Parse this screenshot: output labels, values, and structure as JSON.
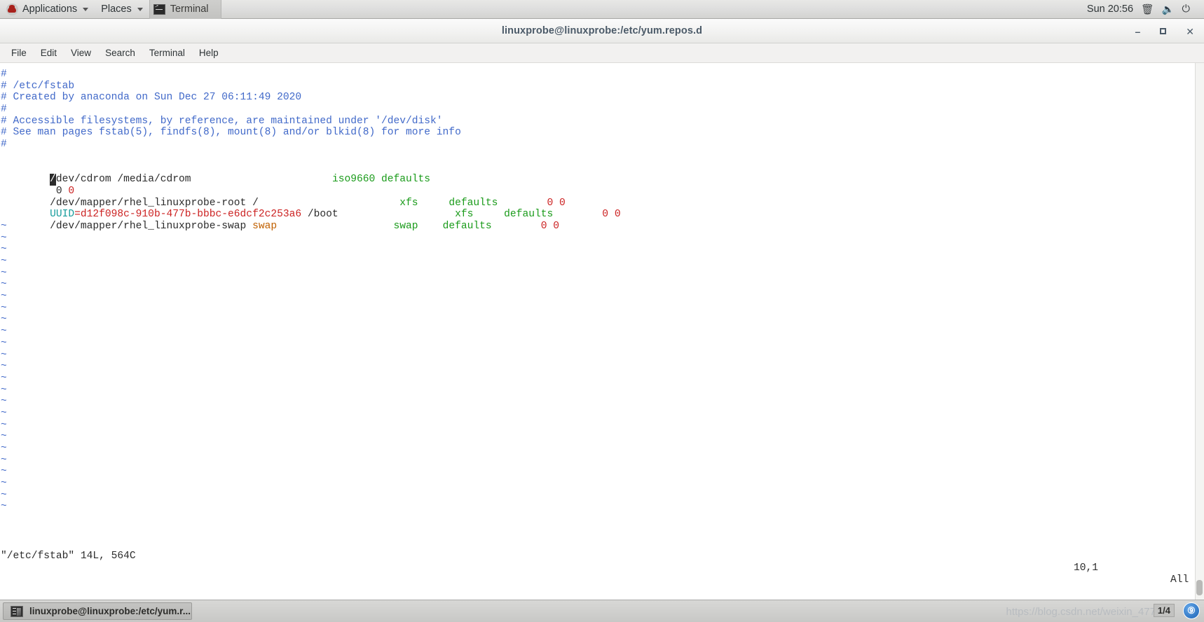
{
  "top_panel": {
    "applications_label": "Applications",
    "places_label": "Places",
    "window_button_label": "Terminal",
    "clock": "Sun 20:56",
    "icons": [
      "redhat-logo-icon",
      "display-icon",
      "volume-icon",
      "power-icon",
      "chevron-down-icon"
    ]
  },
  "window": {
    "title": "linuxprobe@linuxprobe:/etc/yum.repos.d",
    "controls": {
      "minimize": "–",
      "maximize": "",
      "close": "✕"
    },
    "menu": [
      "File",
      "Edit",
      "View",
      "Search",
      "Terminal",
      "Help"
    ]
  },
  "terminal": {
    "comments": [
      "#",
      "# /etc/fstab",
      "# Created by anaconda on Sun Dec 27 06:11:49 2020",
      "#",
      "# Accessible filesystems, by reference, are maintained under '/dev/disk'",
      "# See man pages fstab(5), findfs(8), mount(8) and/or blkid(8) for more info",
      "#"
    ],
    "entries": {
      "cdrom": {
        "cursor_char": "/",
        "device_rest": "dev/cdrom /media/cdrom",
        "spacer1": "                       ",
        "fstype": "iso9660",
        "options": " defaults",
        "wrap_dump_pass": " 0",
        "wrap_pass": " 0"
      },
      "root": {
        "device": "/dev/mapper/rhel_linuxprobe-root /",
        "spacer1": "                       ",
        "fstype": "xfs",
        "spacer2": "     ",
        "options": "defaults",
        "spacer3": "        ",
        "dump": "0",
        "pass": " 0"
      },
      "boot": {
        "uuid_key": "UUID",
        "uuid_value": "=d12f098c-910b-477b-bbbc-e6dcf2c253a6",
        "mount": " /boot",
        "spacer1": "                   ",
        "fstype": "xfs",
        "spacer2": "     ",
        "options": "defaults",
        "spacer3": "        ",
        "dump": "0",
        "pass": " 0"
      },
      "swap": {
        "device": "/dev/mapper/rhel_linuxprobe-swap ",
        "mount": "swap",
        "spacer1": "                   ",
        "fstype": "swap",
        "spacer2": "    ",
        "options": "defaults",
        "spacer3": "        ",
        "dump": "0",
        "pass": " 0"
      }
    },
    "tilde": "~",
    "tilde_count": 25,
    "status": {
      "file_info": "\"/etc/fstab\" 14L, 564C",
      "position": "10,1",
      "scroll_state": "All"
    }
  },
  "taskbar": {
    "window_label": "linuxprobe@linuxprobe:/etc/yum.r...",
    "watermark": "https://blog.csdn.net/weixin_477498",
    "workspace_indicator": "1/4",
    "workspace_badge": "⑨"
  },
  "colors": {
    "comment_blue": "#4169c9",
    "value_green": "#1a9b1a",
    "number_red": "#cc2222",
    "uuid_cyan": "#179c9c",
    "swap_orange": "#c06000",
    "text_dark": "#2b2b2b"
  }
}
